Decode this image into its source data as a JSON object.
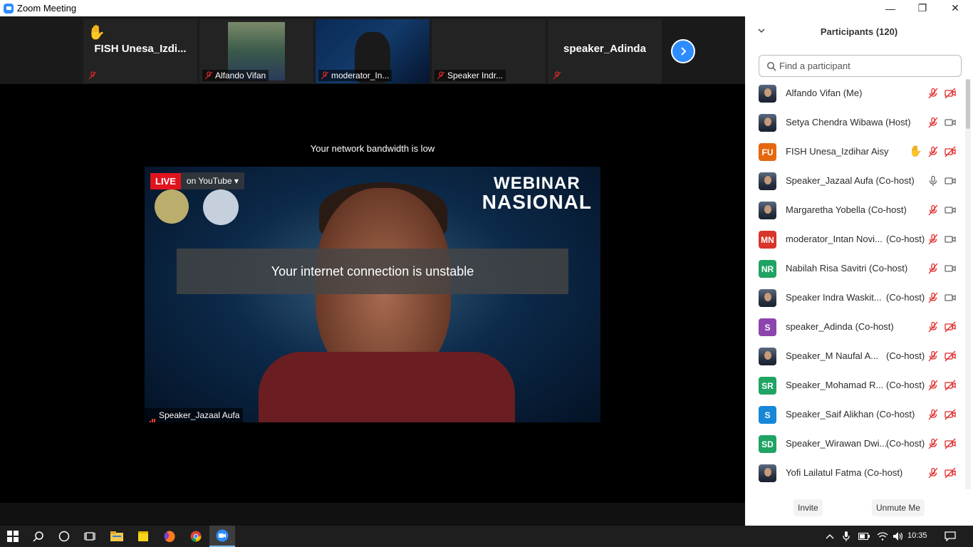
{
  "window": {
    "title": "Zoom Meeting"
  },
  "strip": {
    "tiles": [
      {
        "label": "FISH  Unesa_Izdi..."
      },
      {
        "label": "Alfando Vifan"
      },
      {
        "label": "moderator_In..."
      },
      {
        "label": "Speaker Indr..."
      },
      {
        "label": "speaker_Adinda"
      }
    ]
  },
  "stage": {
    "bandwidth_notice": "Your network bandwidth is low",
    "live_tag": "LIVE",
    "live_platform": "on YouTube",
    "banner_line1": "WEBINAR",
    "banner_line2": "NASIONAL",
    "unstable_notice": "Your internet connection is unstable",
    "speaker_label": "Speaker_Jazaal Aufa"
  },
  "panel": {
    "title": "Participants (120)",
    "search_placeholder": "Find a participant",
    "participants": [
      {
        "name": "Alfando Vifan (Me)",
        "role": "",
        "avatar": "photo",
        "initials": "",
        "color": "",
        "mic": "muted",
        "video": "off",
        "hand": false
      },
      {
        "name": "Setya Chendra Wibawa (Host)",
        "role": "",
        "avatar": "photo",
        "initials": "",
        "color": "",
        "mic": "muted",
        "video": "on",
        "hand": false
      },
      {
        "name": "FISH Unesa_Izdihar Aisy",
        "role": "",
        "avatar": "initials",
        "initials": "FU",
        "color": "#e5670f",
        "mic": "muted",
        "video": "off",
        "hand": true
      },
      {
        "name": "Speaker_Jazaal Aufa (Co-host)",
        "role": "",
        "avatar": "photo",
        "initials": "",
        "color": "",
        "mic": "on",
        "video": "on",
        "hand": false
      },
      {
        "name": "Margaretha Yobella (Co-host)",
        "role": "",
        "avatar": "photo",
        "initials": "",
        "color": "",
        "mic": "muted",
        "video": "on",
        "hand": false
      },
      {
        "name": "moderator_Intan Novi...",
        "role": "(Co-host)",
        "avatar": "initials",
        "initials": "MN",
        "color": "#d9352a",
        "mic": "muted",
        "video": "on",
        "hand": false
      },
      {
        "name": "Nabilah Risa Savitri (Co-host)",
        "role": "",
        "avatar": "initials",
        "initials": "NR",
        "color": "#1fa463",
        "mic": "muted",
        "video": "on",
        "hand": false
      },
      {
        "name": "Speaker Indra Waskit...",
        "role": "(Co-host)",
        "avatar": "photo",
        "initials": "",
        "color": "",
        "mic": "muted",
        "video": "on",
        "hand": false
      },
      {
        "name": "speaker_Adinda (Co-host)",
        "role": "",
        "avatar": "initials",
        "initials": "S",
        "color": "#8e44ad",
        "mic": "muted",
        "video": "off",
        "hand": false
      },
      {
        "name": "Speaker_M Naufal A...",
        "role": "(Co-host)",
        "avatar": "photo",
        "initials": "",
        "color": "",
        "mic": "muted",
        "video": "off",
        "hand": false
      },
      {
        "name": "Speaker_Mohamad R...",
        "role": "(Co-host)",
        "avatar": "initials",
        "initials": "SR",
        "color": "#1fa463",
        "mic": "muted",
        "video": "off",
        "hand": false
      },
      {
        "name": "Speaker_Saif Alikhan (Co-host)",
        "role": "",
        "avatar": "initials",
        "initials": "S",
        "color": "#1787d8",
        "mic": "muted",
        "video": "off",
        "hand": false
      },
      {
        "name": "Speaker_Wirawan Dwi...",
        "role": "(Co-host)",
        "avatar": "initials",
        "initials": "SD",
        "color": "#1fa463",
        "mic": "muted",
        "video": "off",
        "hand": false
      },
      {
        "name": "Yofi Lailatul Fatma (Co-host)",
        "role": "",
        "avatar": "photo",
        "initials": "",
        "color": "",
        "mic": "muted",
        "video": "off",
        "hand": false
      }
    ],
    "invite_label": "Invite",
    "unmute_label": "Unmute Me"
  },
  "taskbar": {
    "time": "10:35"
  },
  "colors": {
    "accent": "#2d8cff",
    "muted_red": "#e02828",
    "live_red": "#e0141e"
  }
}
